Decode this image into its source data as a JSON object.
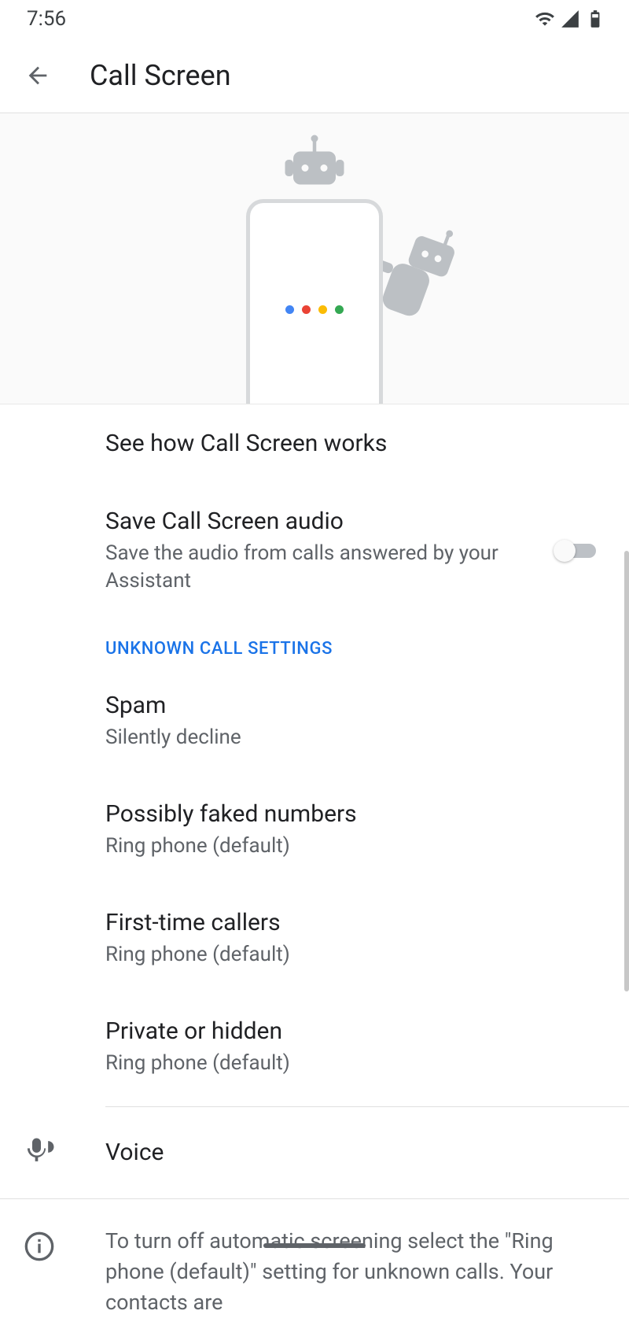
{
  "status": {
    "time": "7:56"
  },
  "appbar": {
    "title": "Call Screen"
  },
  "items": {
    "howItWorks": {
      "title": "See how Call Screen works"
    },
    "saveAudio": {
      "title": "Save Call Screen audio",
      "subtitle": "Save the audio from calls answered by your Assistant",
      "enabled": false
    }
  },
  "sectionLabel": "UNKNOWN CALL SETTINGS",
  "unknown": [
    {
      "title": "Spam",
      "value": "Silently decline"
    },
    {
      "title": "Possibly faked numbers",
      "value": "Ring phone (default)"
    },
    {
      "title": "First-time callers",
      "value": "Ring phone (default)"
    },
    {
      "title": "Private or hidden",
      "value": "Ring phone (default)"
    }
  ],
  "voice": {
    "title": "Voice"
  },
  "footer": {
    "text": "To turn off automatic screening select the \"Ring phone (default)\" setting for unknown calls. Your contacts are"
  },
  "colors": {
    "accent": "#1a73e8",
    "google_blue": "#4285F4",
    "google_red": "#EA4335",
    "google_yellow": "#FBBC05",
    "google_green": "#34A853"
  }
}
